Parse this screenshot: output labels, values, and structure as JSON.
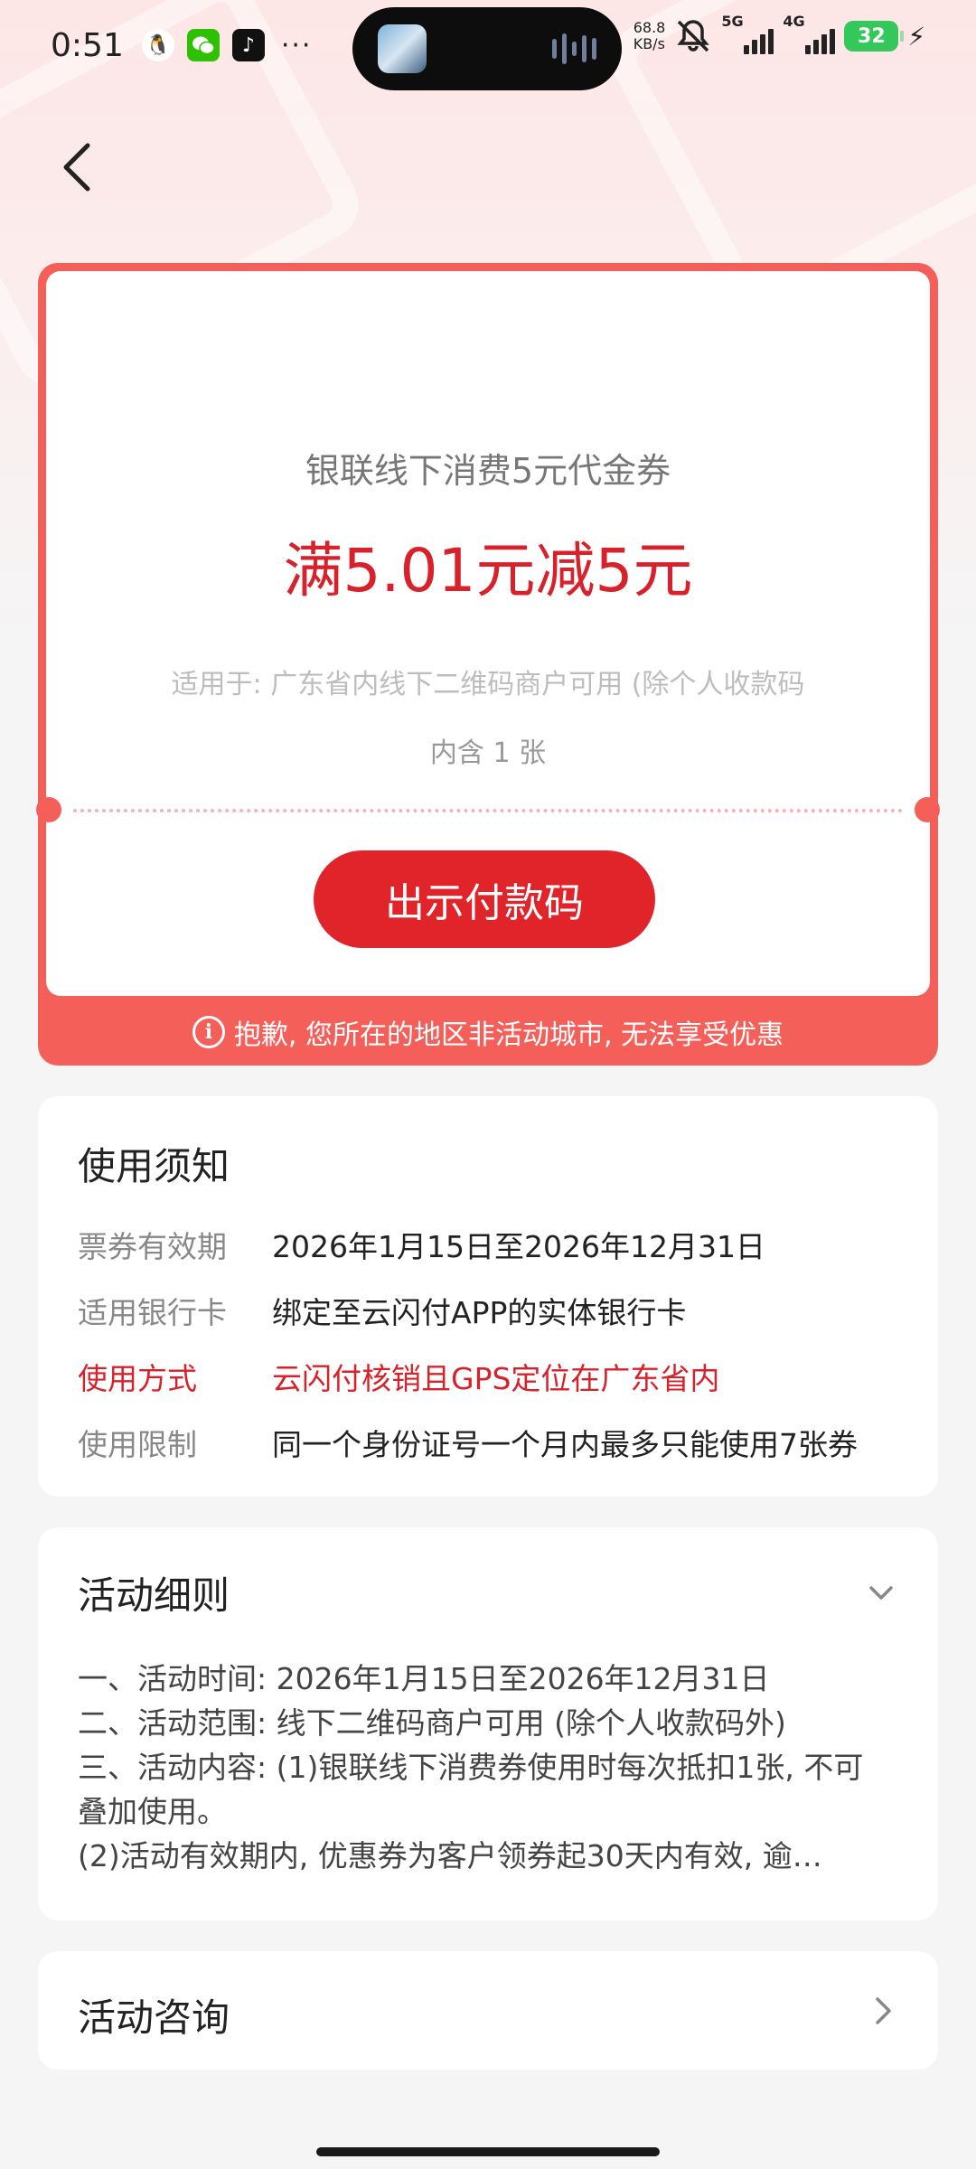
{
  "status_bar": {
    "time": "0:51",
    "net_speed_value": "68.8",
    "net_speed_unit": "KB/s",
    "signal1_label": "5G",
    "signal2_label": "4G",
    "battery": "32",
    "more": "···",
    "app_icons": [
      "qq-icon",
      "wechat-icon",
      "tiktok-icon"
    ]
  },
  "coupon": {
    "name": "银联线下消费5元代金券",
    "value": "满5.01元减5元",
    "scope": "适用于: 广东省内线下二维码商户可用 (除个人收款码",
    "count": "内含 1 张",
    "pay_button": "出示付款码",
    "warning": "抱歉, 您所在的地区非活动城市, 无法享受优惠",
    "colors": {
      "accent": "#e1232a",
      "border": "#f45f5a"
    }
  },
  "notice": {
    "title": "使用须知",
    "rows": [
      {
        "k": "票券有效期",
        "v": "2026年1月15日至2026年12月31日"
      },
      {
        "k": "适用银行卡",
        "v": "绑定至云闪付APP的实体银行卡"
      },
      {
        "k": "使用方式",
        "v": "云闪付核销且GPS定位在广东省内"
      },
      {
        "k": "使用限制",
        "v": "同一个身份证号一个月内最多只能使用7张券"
      }
    ]
  },
  "rules": {
    "title": "活动细则",
    "lines": [
      "一、活动时间: 2026年1月15日至2026年12月31日",
      "二、活动范围: 线下二维码商户可用 (除个人收款码外)",
      "三、活动内容: (1)银联线下消费券使用时每次抵扣1张, 不可",
      "叠加使用。",
      "(2)活动有效期内, 优惠券为客户领券起30天内有效, 逾…"
    ]
  },
  "consult": {
    "title": "活动咨询"
  }
}
